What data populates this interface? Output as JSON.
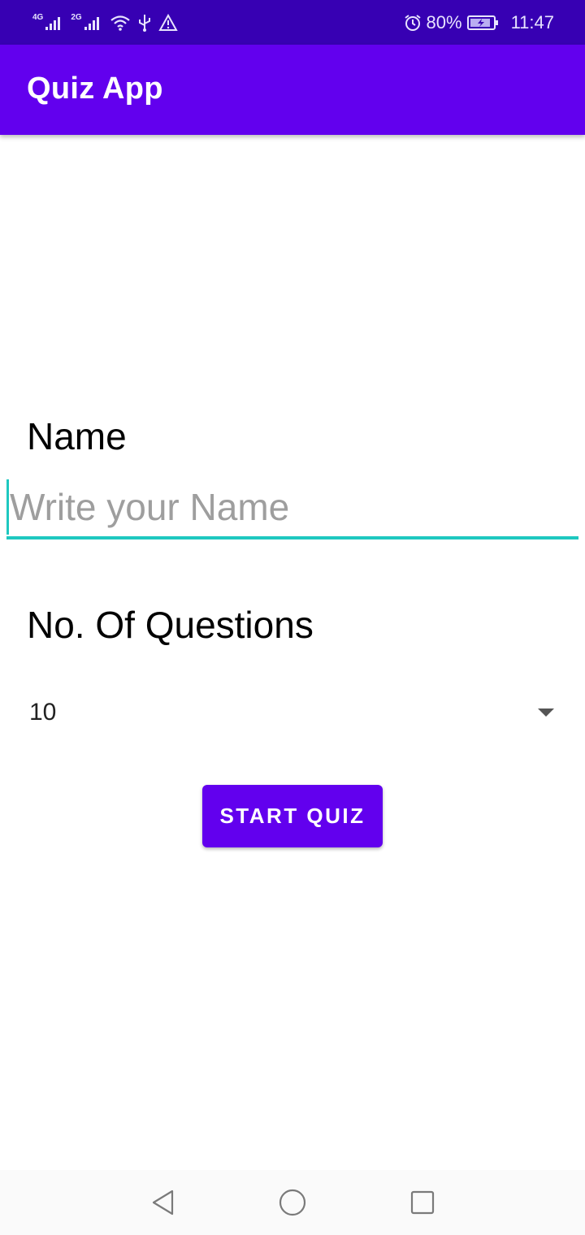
{
  "status_bar": {
    "network_1": "4G",
    "network_2": "2G",
    "battery_percent": "80%",
    "time": "11:47",
    "icons": [
      "signal-icon",
      "signal-icon",
      "wifi-icon",
      "usb-icon",
      "warning-icon",
      "alarm-icon",
      "battery-charging-icon"
    ]
  },
  "app_bar": {
    "title": "Quiz App"
  },
  "form": {
    "name_label": "Name",
    "name_placeholder": "Write your Name",
    "name_value": "",
    "questions_label": "No. Of Questions",
    "questions_selected": "10",
    "start_button": "START QUIZ"
  },
  "nav_bar": {
    "icons": [
      "back-icon",
      "home-icon",
      "recents-icon"
    ]
  },
  "colors": {
    "status_bar": "#3700b3",
    "primary": "#6200ee",
    "accent": "#1ec8c0",
    "hint": "#9e9e9e"
  }
}
